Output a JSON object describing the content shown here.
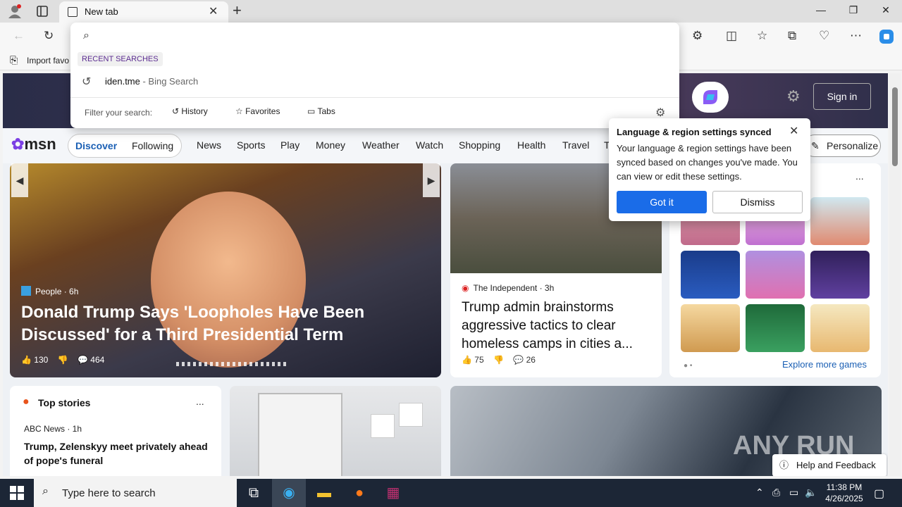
{
  "tab": {
    "title": "New tab"
  },
  "favbar": {
    "import_label": "Import favo"
  },
  "dropdown": {
    "recent_label": "RECENT SEARCHES",
    "item_query": "iden.tme",
    "item_sub": " - Bing Search",
    "filter_label": "Filter your search:",
    "options": [
      "History",
      "Favorites",
      "Tabs"
    ]
  },
  "msn": {
    "logo": "msn",
    "signin": "Sign in",
    "discover": "Discover",
    "following": "Following",
    "nav": [
      "News",
      "Sports",
      "Play",
      "Money",
      "Weather",
      "Watch",
      "Shopping",
      "Health",
      "Travel",
      "T"
    ],
    "personalize": "Personalize"
  },
  "main_story": {
    "source": "People · 6h",
    "title": "Donald Trump Says 'Loopholes Have Been Discussed' for a Third Presidential Term",
    "likes": "130",
    "comments": "464"
  },
  "story2": {
    "source": "The Independent · 3h",
    "title": "Trump admin brainstorms aggressive tactics to clear homeless camps in cities a...",
    "likes": "75",
    "comments": "26"
  },
  "games": {
    "more": "...",
    "explore": "Explore more games"
  },
  "top_stories": {
    "title": "Top stories",
    "more": "...",
    "source": "ABC News · 1h",
    "headline": "Trump, Zelenskyy meet privately ahead of pope's funeral"
  },
  "popup": {
    "title": "Language & region settings synced",
    "body": "Your language & region settings have been synced based on changes you've made. You can view or edit these settings.",
    "gotit": "Got it",
    "dismiss": "Dismiss"
  },
  "watermark": "ANY RUN",
  "help": "Help and Feedback",
  "taskbar": {
    "search_placeholder": "Type here to search",
    "time": "11:38 PM",
    "date": "4/26/2025"
  }
}
